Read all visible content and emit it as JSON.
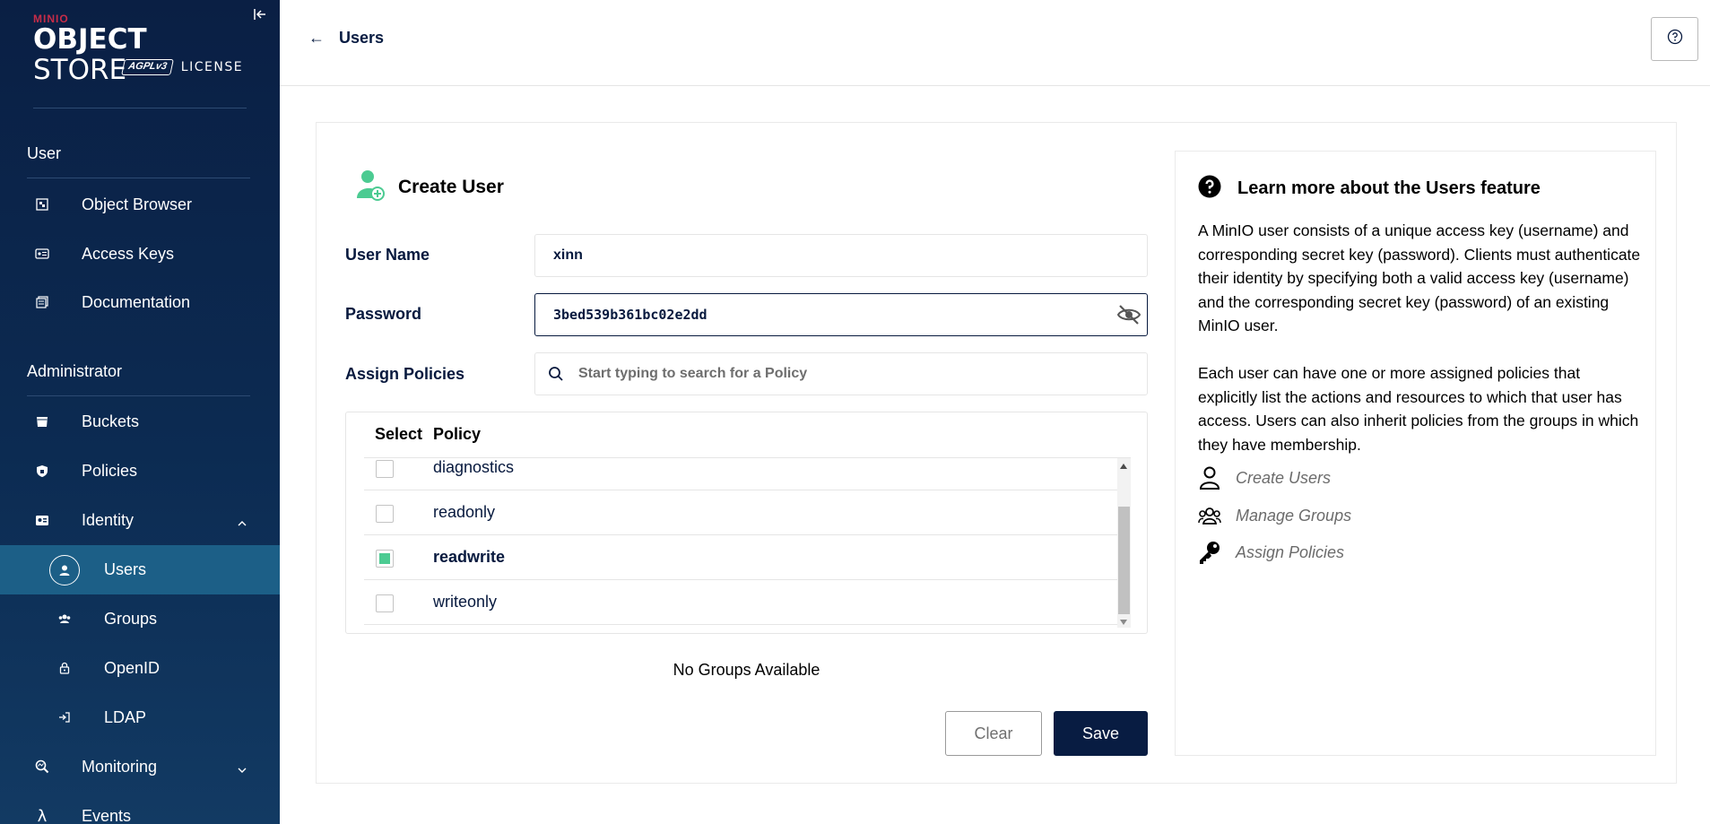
{
  "sidebar": {
    "logo": {
      "brand": "MINIO",
      "product_bold": "OBJECT",
      "product_light": "STORE",
      "badge": "AGPLv3",
      "license": "LICENSE"
    },
    "sections": [
      {
        "title": "User"
      },
      {
        "title": "Administrator"
      }
    ],
    "items": [
      {
        "label": "Object Browser",
        "icon": "object-browser-icon"
      },
      {
        "label": "Access Keys",
        "icon": "access-keys-icon"
      },
      {
        "label": "Documentation",
        "icon": "documentation-icon"
      },
      {
        "label": "Buckets",
        "icon": "bucket-icon"
      },
      {
        "label": "Policies",
        "icon": "shield-icon"
      },
      {
        "label": "Identity",
        "icon": "identity-icon",
        "expanded": true
      },
      {
        "label": "Users",
        "icon": "user-icon",
        "active": true
      },
      {
        "label": "Groups",
        "icon": "groups-icon"
      },
      {
        "label": "OpenID",
        "icon": "lock-icon"
      },
      {
        "label": "LDAP",
        "icon": "login-icon"
      },
      {
        "label": "Monitoring",
        "icon": "monitoring-icon",
        "expanded": false
      },
      {
        "label": "Events",
        "icon": "lambda-icon"
      }
    ]
  },
  "header": {
    "back_label": "Users",
    "help_icon": "question-icon"
  },
  "form": {
    "title": "Create User",
    "username_label": "User Name",
    "username_value": "xinn",
    "password_label": "Password",
    "password_value": "3bed539b361bc02e2dd",
    "policies_label": "Assign Policies",
    "policy_search_placeholder": "Start typing to search for a Policy",
    "table": {
      "col_select": "Select",
      "col_policy": "Policy",
      "rows": [
        {
          "name": "diagnostics",
          "checked": false
        },
        {
          "name": "readonly",
          "checked": false
        },
        {
          "name": "readwrite",
          "checked": true
        },
        {
          "name": "writeonly",
          "checked": false
        }
      ]
    },
    "no_groups": "No Groups Available",
    "clear_label": "Clear",
    "save_label": "Save"
  },
  "help": {
    "title": "Learn more about the Users feature",
    "para1": "A MinIO user consists of a unique access key (username) and corresponding secret key (password). Clients must authenticate their identity by specifying both a valid access key (username) and the corresponding secret key (password) of an existing MinIO user.",
    "para2": "Each user can have one or more assigned policies that explicitly list the actions and resources to which that user has access. Users can also inherit policies from the groups in which they have membership.",
    "links": [
      {
        "label": "Create Users",
        "icon": "user-outline-icon"
      },
      {
        "label": "Manage Groups",
        "icon": "groups-outline-icon"
      },
      {
        "label": "Assign Policies",
        "icon": "key-icon"
      }
    ]
  },
  "colors": {
    "sidebar_bg": "#0a1f44",
    "active_item": "#1c5f87",
    "accent_green": "#4ccb92",
    "primary_dark": "#081c42",
    "brand_red": "#c72c48"
  }
}
